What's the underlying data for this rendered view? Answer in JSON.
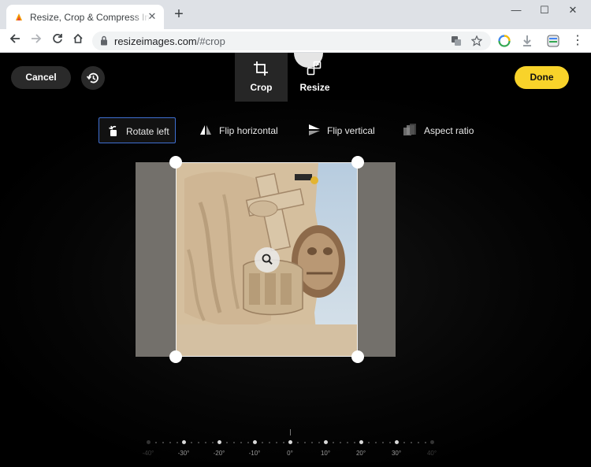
{
  "browser": {
    "tab_title": "Resize, Crop & Compress Images",
    "tab_close": "✕",
    "new_tab": "+",
    "url_host": "resizeimages.com",
    "url_path": "/#crop",
    "window_controls": [
      "—",
      "☐",
      "✕"
    ]
  },
  "app": {
    "cancel_label": "Cancel",
    "done_label": "Done",
    "modes": [
      {
        "label": "Crop",
        "active": true
      },
      {
        "label": "Resize",
        "active": false
      }
    ],
    "tools": [
      {
        "label": "Rotate left",
        "selected": true
      },
      {
        "label": "Flip horizontal",
        "selected": false
      },
      {
        "label": "Flip vertical",
        "selected": false
      },
      {
        "label": "Aspect ratio",
        "selected": false
      }
    ],
    "ruler_labels": [
      "-40°",
      "-30°",
      "-20°",
      "-10°",
      "0°",
      "10°",
      "20°",
      "30°",
      "40°"
    ],
    "accent_color": "#f8d32a",
    "selection_color": "#3f6fd1"
  }
}
